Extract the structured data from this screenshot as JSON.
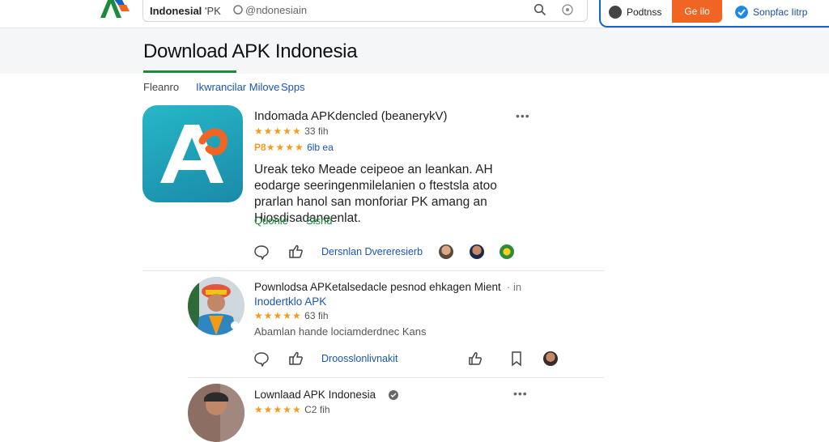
{
  "header": {
    "site_name": "Indonesial",
    "site_apk": "'PK",
    "search_placeholder": "@ndonesiain",
    "btn_podcast": "Podtnss",
    "btn_orange": "Ge ilo",
    "btn_help": "Sonpfac Iitrp"
  },
  "page": {
    "title": "Download APK Indonesia",
    "tabs": [
      "Fleanro",
      "Ikwrancilar Milove",
      "Spps"
    ]
  },
  "card1": {
    "title": "Indomada APKdencled (beanerykV)",
    "rating1": "33 fih",
    "rating2_prefix": "P8",
    "rating2": "6lb ea",
    "description": "Ureak teko Meade ceipeoe an leankan. AH eodarge seeringenmilelanien o ftestsla atoo prarlan hanol san monforiar PK amang an Hiosdisadaneenlat.",
    "tag_green": "Quonle",
    "tag_green2": "Slsnd",
    "action_link": "Dersnlan Dvereresierb",
    "more": "•••"
  },
  "card2": {
    "title": "Pownlodsa APKetalsedacle pesnod ehkagen Mient",
    "time": "· in",
    "subtitle": "Inodertklo APK",
    "rating": "63 fih",
    "description": "Abamlan hande lociamderdnec Kans",
    "action_link": "Droosslonlivnakit"
  },
  "card3": {
    "title": "Lownlaad APK Indonesia",
    "rating": "C2 fih",
    "more": "•••"
  },
  "colors": {
    "accent_blue": "#1565c0",
    "orange": "#f06424",
    "green": "#1e8a3c",
    "star": "#f29c1f"
  }
}
